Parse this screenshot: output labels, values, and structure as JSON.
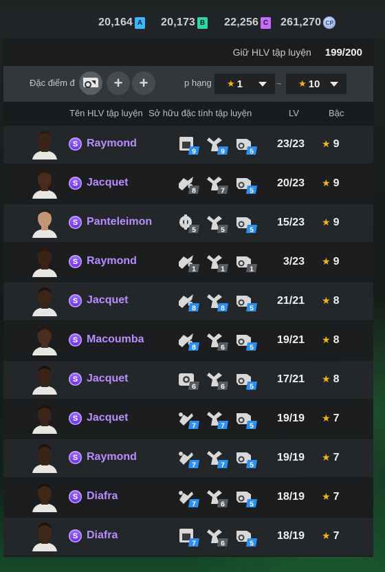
{
  "currencies": [
    {
      "value": "20,164",
      "badge": "A",
      "color": "#3fb4ff"
    },
    {
      "value": "20,173",
      "badge": "B",
      "color": "#2fd6a6"
    },
    {
      "value": "22,256",
      "badge": "C",
      "color": "#c86bff"
    },
    {
      "value": "261,270",
      "badge": "CP",
      "color": "#a7b7ff"
    }
  ],
  "coach_count": {
    "label": "Giữ HLV tập luyện",
    "value": "199/200"
  },
  "filter": {
    "trait_label": "Đặc điểm đ",
    "rank_label": "p hạng",
    "rank_min": "1",
    "rank_sep": "~",
    "rank_max": "10"
  },
  "columns": {
    "name": "Tên HLV tập luyện",
    "traits": "Sở hữu đặc tính tập luyện",
    "lv": "LV",
    "grade": "Bậc"
  },
  "colors": {
    "accent_name": "#b98cff",
    "star": "#f4b719",
    "trait_blue": "#2a8ff0",
    "trait_gray": "#5a5d60"
  },
  "rows": [
    {
      "name": "Raymond",
      "badge": "S",
      "traits": [
        {
          "icon": "training-icon",
          "level": "9",
          "style": "blue"
        },
        {
          "icon": "trophy-icon",
          "level": "9",
          "style": "blue"
        },
        {
          "icon": "ball-icon",
          "level": "5",
          "style": "blue"
        }
      ],
      "lv": "23/23",
      "grade": "9"
    },
    {
      "name": "Jacquet",
      "badge": "S",
      "traits": [
        {
          "icon": "tackle-icon",
          "level": "8",
          "style": "gray"
        },
        {
          "icon": "trophy-icon",
          "level": "7",
          "style": "gray"
        },
        {
          "icon": "ball-icon",
          "level": "5",
          "style": "blue"
        }
      ],
      "lv": "20/23",
      "grade": "9"
    },
    {
      "name": "Panteleimon",
      "badge": "S",
      "traits": [
        {
          "icon": "gear-icon",
          "level": "5",
          "style": "gray"
        },
        {
          "icon": "trophy-icon",
          "level": "5",
          "style": "gray"
        },
        {
          "icon": "ball-icon",
          "level": "5",
          "style": "blue"
        }
      ],
      "lv": "15/23",
      "grade": "9"
    },
    {
      "name": "Raymond",
      "badge": "S",
      "traits": [
        {
          "icon": "tackle-icon",
          "level": "1",
          "style": "gray"
        },
        {
          "icon": "trophy-icon",
          "level": "1",
          "style": "gray"
        },
        {
          "icon": "ball-icon",
          "level": "1",
          "style": "gray"
        }
      ],
      "lv": "3/23",
      "grade": "9"
    },
    {
      "name": "Jacquet",
      "badge": "S",
      "traits": [
        {
          "icon": "tackle-icon",
          "level": "8",
          "style": "blue"
        },
        {
          "icon": "trophy-icon",
          "level": "8",
          "style": "blue"
        },
        {
          "icon": "ball-icon",
          "level": "5",
          "style": "blue"
        }
      ],
      "lv": "21/21",
      "grade": "8"
    },
    {
      "name": "Macoumba",
      "badge": "S",
      "traits": [
        {
          "icon": "tackle-icon",
          "level": "8",
          "style": "blue"
        },
        {
          "icon": "trophy-icon",
          "level": "6",
          "style": "gray"
        },
        {
          "icon": "ball-icon",
          "level": "5",
          "style": "blue"
        }
      ],
      "lv": "19/21",
      "grade": "8"
    },
    {
      "name": "Jacquet",
      "badge": "S",
      "traits": [
        {
          "icon": "camera-icon",
          "level": "6",
          "style": "gray"
        },
        {
          "icon": "trophy-icon",
          "level": "6",
          "style": "gray"
        },
        {
          "icon": "ball-icon",
          "level": "5",
          "style": "blue"
        }
      ],
      "lv": "17/21",
      "grade": "8"
    },
    {
      "name": "Jacquet",
      "badge": "S",
      "traits": [
        {
          "icon": "kick-icon",
          "level": "7",
          "style": "blue"
        },
        {
          "icon": "trophy-icon",
          "level": "7",
          "style": "blue"
        },
        {
          "icon": "ball-icon",
          "level": "5",
          "style": "blue"
        }
      ],
      "lv": "19/19",
      "grade": "7"
    },
    {
      "name": "Raymond",
      "badge": "S",
      "traits": [
        {
          "icon": "kick-icon",
          "level": "7",
          "style": "blue"
        },
        {
          "icon": "trophy-icon",
          "level": "7",
          "style": "blue"
        },
        {
          "icon": "ball-icon",
          "level": "5",
          "style": "blue"
        }
      ],
      "lv": "19/19",
      "grade": "7"
    },
    {
      "name": "Diafra",
      "badge": "S",
      "traits": [
        {
          "icon": "kick-icon",
          "level": "7",
          "style": "blue"
        },
        {
          "icon": "trophy-icon",
          "level": "6",
          "style": "gray"
        },
        {
          "icon": "ball-icon",
          "level": "5",
          "style": "blue"
        }
      ],
      "lv": "18/19",
      "grade": "7"
    },
    {
      "name": "Diafra",
      "badge": "S",
      "traits": [
        {
          "icon": "training-icon",
          "level": "7",
          "style": "blue"
        },
        {
          "icon": "trophy-icon",
          "level": "6",
          "style": "gray"
        },
        {
          "icon": "ball-icon",
          "level": "5",
          "style": "blue"
        }
      ],
      "lv": "18/19",
      "grade": "7"
    }
  ]
}
